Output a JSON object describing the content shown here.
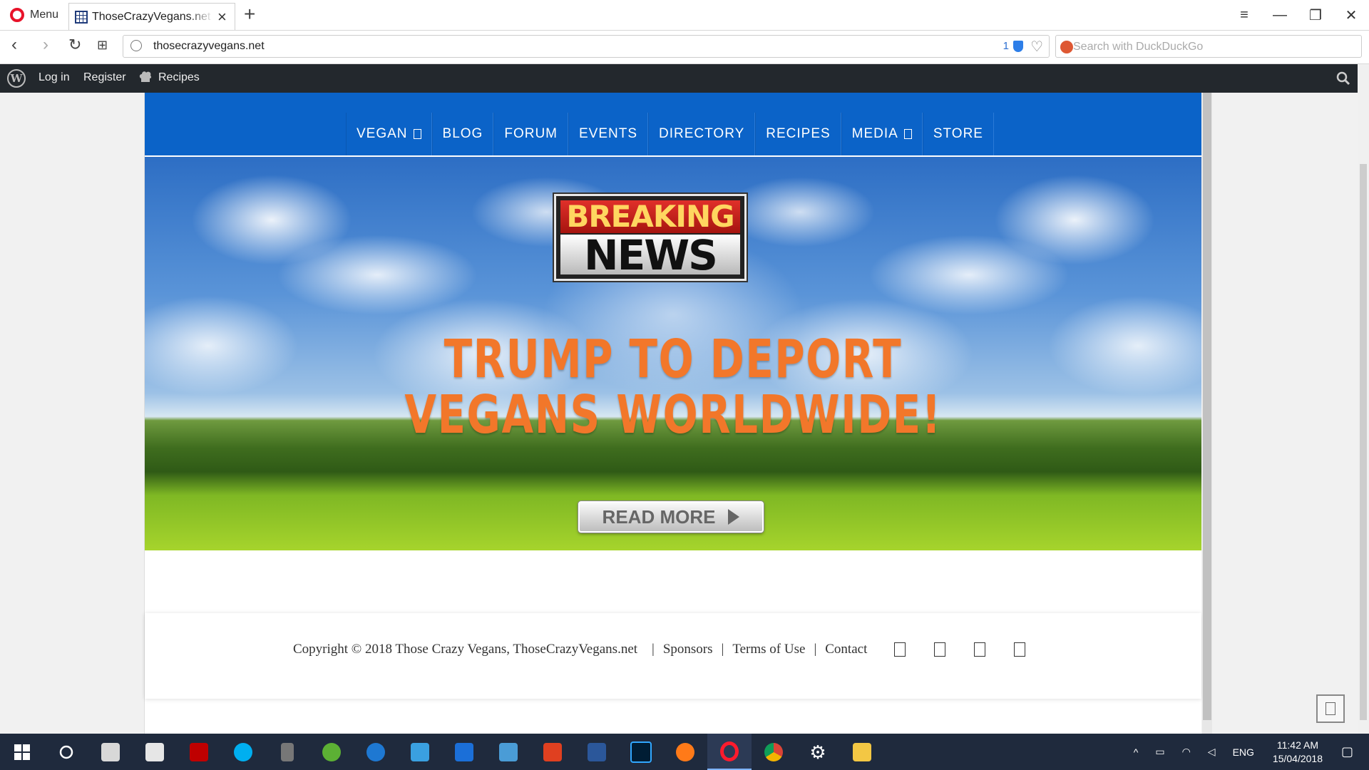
{
  "browser": {
    "menu_label": "Menu",
    "tab_title": "ThoseCrazyVegans.net - Those Crazy Vegans",
    "url": "thosecrazyvegans.net",
    "blocked_count": "1",
    "search_placeholder": "Search with DuckDuckGo"
  },
  "adminbar": {
    "login": "Log in",
    "register": "Register",
    "recipes": "Recipes"
  },
  "nav": {
    "items": [
      "VEGAN",
      "BLOG",
      "FORUM",
      "EVENTS",
      "DIRECTORY",
      "RECIPES",
      "MEDIA",
      "STORE"
    ]
  },
  "hero": {
    "badge_top": "BREAKING",
    "badge_bottom": "NEWS",
    "headline_line1": "TRUMP TO DEPORT",
    "headline_line2": "VEGANS WORLDWIDE!",
    "button_label": "READ MORE"
  },
  "footer": {
    "copyright": "Copyright © 2018 Those Crazy Vegans, ThoseCrazyVegans.net",
    "links": [
      "Sponsors",
      "Terms of Use",
      "Contact"
    ]
  },
  "taskbar": {
    "language": "ENG",
    "time": "11:42 AM",
    "date": "15/04/2018"
  },
  "colors": {
    "nav_blue": "#0b63c8",
    "headline_orange": "#f2772a",
    "admin_bar": "#23282d",
    "taskbar": "#1f2a3d"
  }
}
